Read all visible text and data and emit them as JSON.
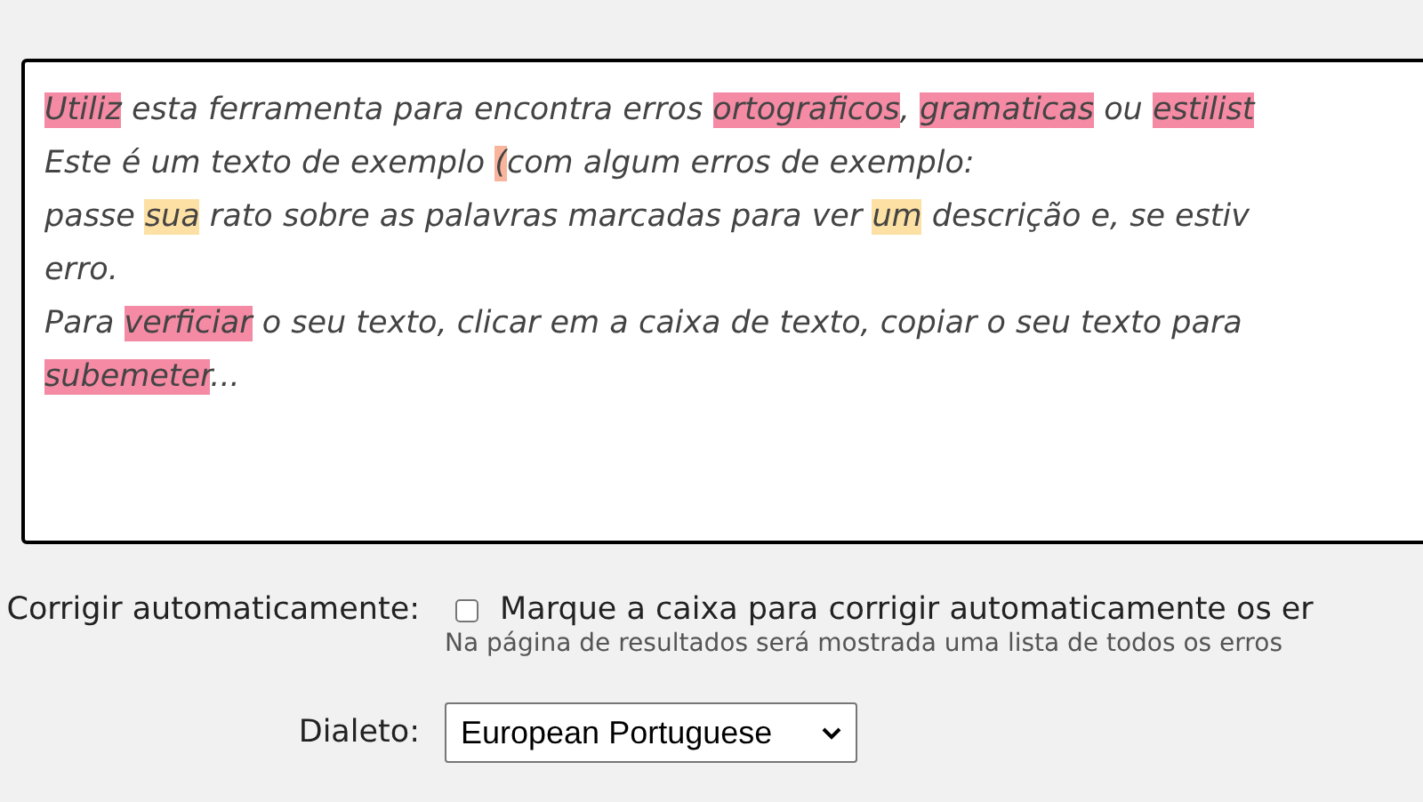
{
  "editor": {
    "lines": [
      [
        {
          "text": "Utiliz",
          "color": "#f48aa3"
        },
        {
          "text": " esta ferramenta para encontra erros "
        },
        {
          "text": "ortograficos",
          "color": "#f48aa3"
        },
        {
          "text": ", "
        },
        {
          "text": "gramaticas",
          "color": "#f48aa3"
        },
        {
          "text": " ou "
        },
        {
          "text": "estilist",
          "color": "#f48aa3"
        }
      ],
      [
        {
          "text": "Este é um texto de exemplo "
        },
        {
          "text": "(",
          "color": "#f9b49c"
        },
        {
          "text": "com algum erros de exemplo:"
        }
      ],
      [
        {
          "text": "passe "
        },
        {
          "text": "sua",
          "color": "#fde0a3"
        },
        {
          "text": " rato sobre as palavras marcadas para ver "
        },
        {
          "text": "um",
          "color": "#fde0a3"
        },
        {
          "text": " descrição e, se estiv"
        }
      ],
      [
        {
          "text": "erro."
        }
      ],
      [
        {
          "text": "Para "
        },
        {
          "text": "verficiar",
          "color": "#f48aa3"
        },
        {
          "text": " o seu texto, clicar em a caixa de texto, copiar o seu texto para"
        }
      ],
      [
        {
          "text": "subemeter",
          "color": "#f48aa3"
        },
        {
          "text": "..."
        }
      ]
    ]
  },
  "autocorrect": {
    "label": "Corrigir automaticamente:",
    "checked": false,
    "checkbox_label": "Marque a caixa para corrigir automaticamente os er",
    "hint": "Na página de resultados será mostrada uma lista de todos os erros"
  },
  "dialect": {
    "label": "Dialeto:",
    "value": "European Portuguese"
  }
}
